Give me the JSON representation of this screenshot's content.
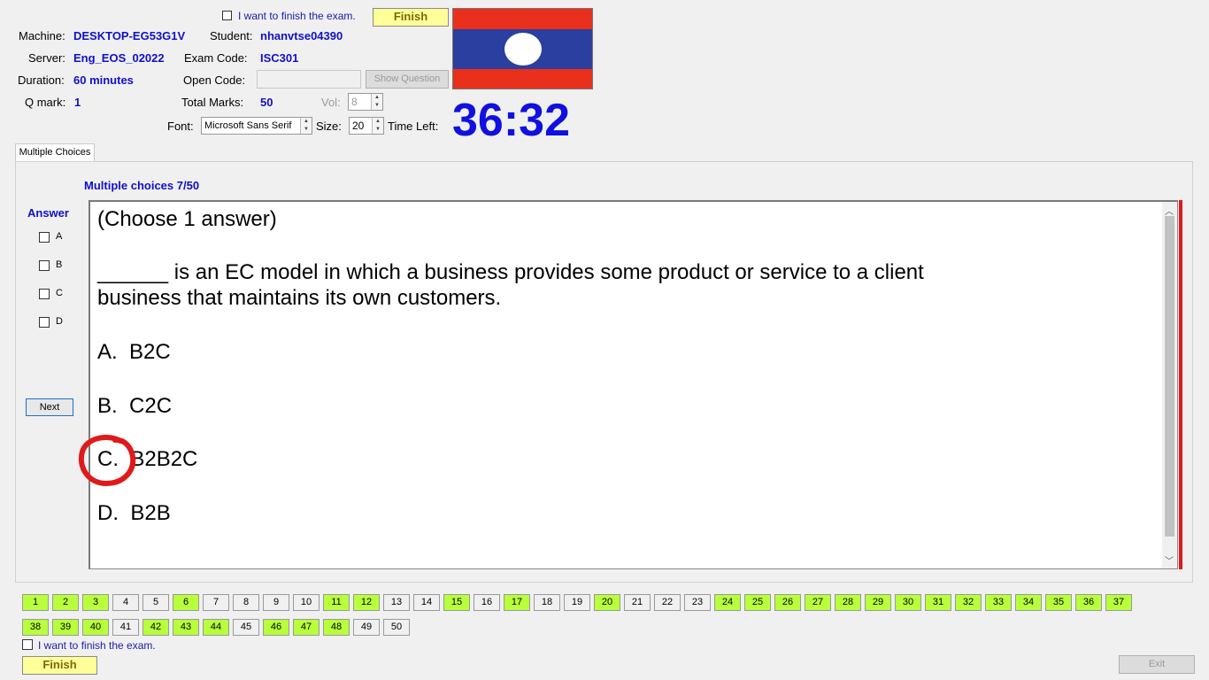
{
  "header": {
    "finish_check_label": "I want to finish the exam.",
    "finish_label": "Finish",
    "machine_label": "Machine:",
    "machine_value": "DESKTOP-EG53G1V",
    "student_label": "Student:",
    "student_value": "nhanvtse04390",
    "server_label": "Server:",
    "server_value": "Eng_EOS_02022",
    "exam_code_label": "Exam Code:",
    "exam_code_value": "ISC301",
    "duration_label": "Duration:",
    "duration_value": "60 minutes",
    "open_code_label": "Open Code:",
    "open_code_value": "",
    "show_question_label": "Show Question",
    "qmark_label": "Q mark:",
    "qmark_value": "1",
    "total_marks_label": "Total Marks:",
    "total_marks_value": "50",
    "vol_label": "Vol:",
    "vol_value": "8",
    "font_label": "Font:",
    "font_value": "Microsoft Sans Serif",
    "size_label": "Size:",
    "size_value": "20",
    "time_left_label": "Time Left:",
    "time_left_value": "36:32",
    "flag_colors": {
      "red": "#e8301c",
      "blue": "#2a3fa0",
      "white": "#ffffff"
    }
  },
  "tab": {
    "label": "Multiple Choices"
  },
  "question": {
    "counter": "Multiple choices 7/50",
    "answer_heading": "Answer",
    "choices": [
      "A",
      "B",
      "C",
      "D"
    ],
    "next_label": "Next",
    "instruction": "(Choose 1 answer)",
    "text_line1": "______ is an EC model in which a business provides some product or service to a client",
    "text_line2": "business that maintains its own customers.",
    "options": [
      {
        "letter": "A.",
        "text": "B2C"
      },
      {
        "letter": "B.",
        "text": "C2C"
      },
      {
        "letter": "C.",
        "text": "B2B2C"
      },
      {
        "letter": "D.",
        "text": "B2B"
      }
    ],
    "highlight_color": "#e01a1a"
  },
  "navigator": {
    "answered_color": "#b8ff3c",
    "numbers": [
      {
        "n": "1",
        "answered": true
      },
      {
        "n": "2",
        "answered": true
      },
      {
        "n": "3",
        "answered": true
      },
      {
        "n": "4",
        "answered": false
      },
      {
        "n": "5",
        "answered": false
      },
      {
        "n": "6",
        "answered": true
      },
      {
        "n": "7",
        "answered": false
      },
      {
        "n": "8",
        "answered": false
      },
      {
        "n": "9",
        "answered": false
      },
      {
        "n": "10",
        "answered": false
      },
      {
        "n": "11",
        "answered": true
      },
      {
        "n": "12",
        "answered": true
      },
      {
        "n": "13",
        "answered": false
      },
      {
        "n": "14",
        "answered": false
      },
      {
        "n": "15",
        "answered": true
      },
      {
        "n": "16",
        "answered": false
      },
      {
        "n": "17",
        "answered": true
      },
      {
        "n": "18",
        "answered": false
      },
      {
        "n": "19",
        "answered": false
      },
      {
        "n": "20",
        "answered": true
      },
      {
        "n": "21",
        "answered": false
      },
      {
        "n": "22",
        "answered": false
      },
      {
        "n": "23",
        "answered": false
      },
      {
        "n": "24",
        "answered": true
      },
      {
        "n": "25",
        "answered": true
      },
      {
        "n": "26",
        "answered": true
      },
      {
        "n": "27",
        "answered": true
      },
      {
        "n": "28",
        "answered": true
      },
      {
        "n": "29",
        "answered": true
      },
      {
        "n": "30",
        "answered": true
      },
      {
        "n": "31",
        "answered": true
      },
      {
        "n": "32",
        "answered": true
      },
      {
        "n": "33",
        "answered": true
      },
      {
        "n": "34",
        "answered": true
      },
      {
        "n": "35",
        "answered": true
      },
      {
        "n": "36",
        "answered": true
      },
      {
        "n": "37",
        "answered": true
      },
      {
        "n": "38",
        "answered": true
      },
      {
        "n": "39",
        "answered": true
      },
      {
        "n": "40",
        "answered": true
      },
      {
        "n": "41",
        "answered": false
      },
      {
        "n": "42",
        "answered": true
      },
      {
        "n": "43",
        "answered": true
      },
      {
        "n": "44",
        "answered": true
      },
      {
        "n": "45",
        "answered": false
      },
      {
        "n": "46",
        "answered": true
      },
      {
        "n": "47",
        "answered": true
      },
      {
        "n": "48",
        "answered": true
      },
      {
        "n": "49",
        "answered": false
      },
      {
        "n": "50",
        "answered": false
      }
    ]
  },
  "footer": {
    "finish_check_label": "I want to finish the exam.",
    "finish_label": "Finish",
    "exit_label": "Exit"
  }
}
